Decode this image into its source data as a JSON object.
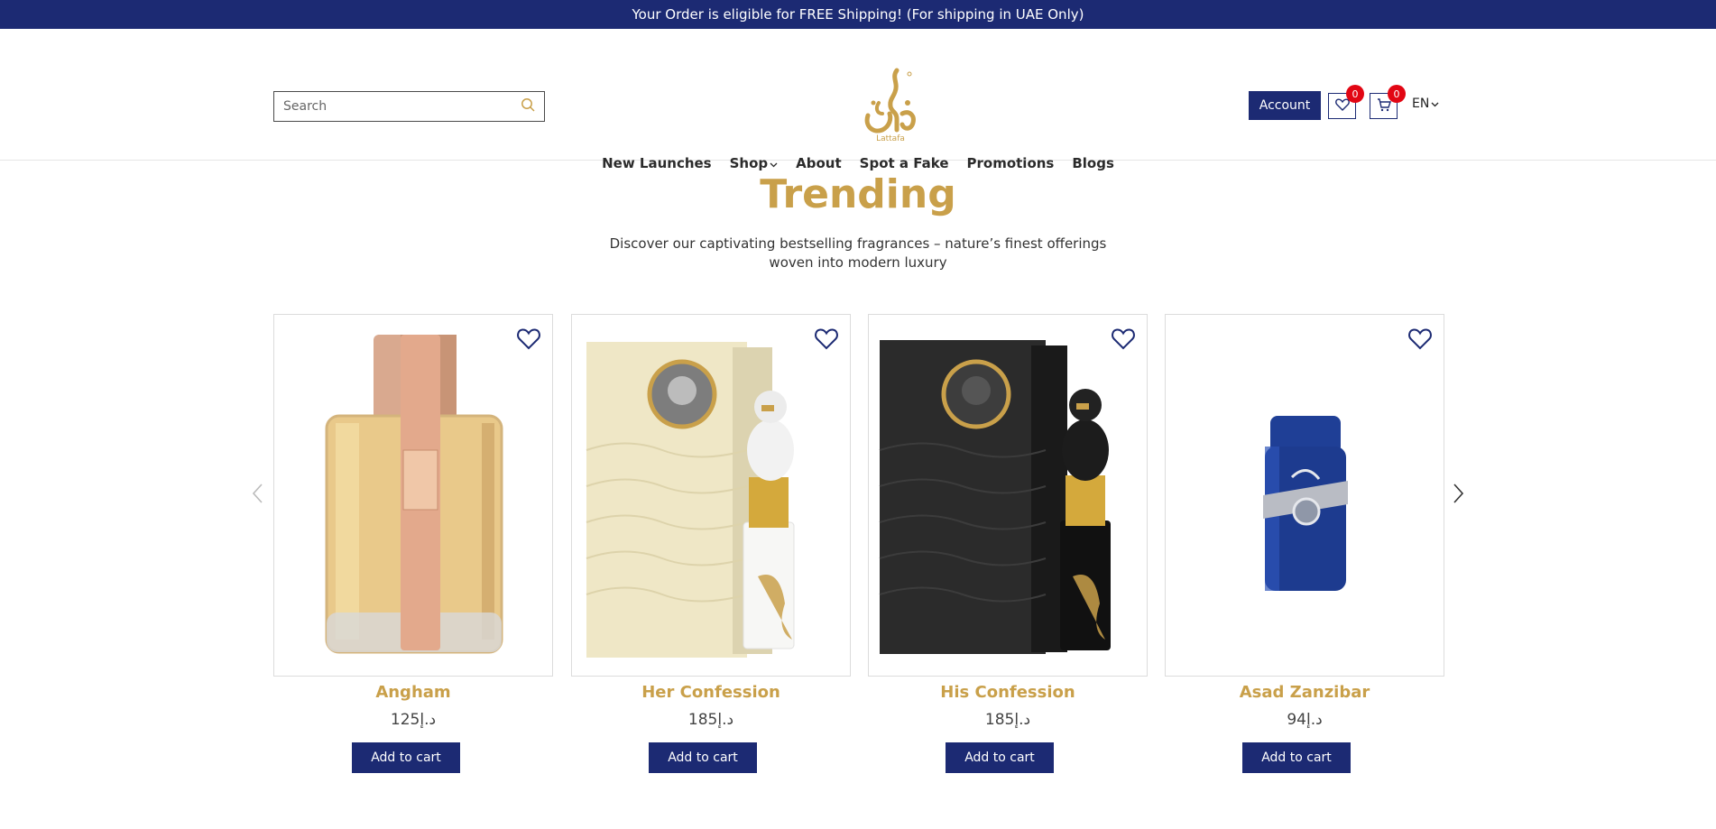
{
  "topbar": {
    "text": "Your Order is eligible for FREE Shipping! (For shipping in UAE Only)"
  },
  "header": {
    "search_placeholder": "Search",
    "logo_text": "Lattafa",
    "account_label": "Account",
    "wishlist_count": "0",
    "cart_count": "0",
    "language": "EN"
  },
  "nav": {
    "items": [
      "New Launches",
      "Shop",
      "About",
      "Spot a Fake",
      "Promotions",
      "Blogs"
    ]
  },
  "section": {
    "title": "Trending",
    "subtitle": "Discover our captivating bestselling fragrances – nature’s finest offerings woven into modern luxury"
  },
  "products": [
    {
      "name": "Angham",
      "price": "125د.إ",
      "button": "Add to cart"
    },
    {
      "name": "Her Confession",
      "price": "185د.إ",
      "button": "Add to cart"
    },
    {
      "name": "His Confession",
      "price": "185د.إ",
      "button": "Add to cart"
    },
    {
      "name": "Asad Zanzibar",
      "price": "94د.إ",
      "button": "Add to cart"
    }
  ],
  "colors": {
    "brand_navy": "#1c2a73",
    "brand_gold": "#c9a04a",
    "badge_red": "#e20613"
  }
}
